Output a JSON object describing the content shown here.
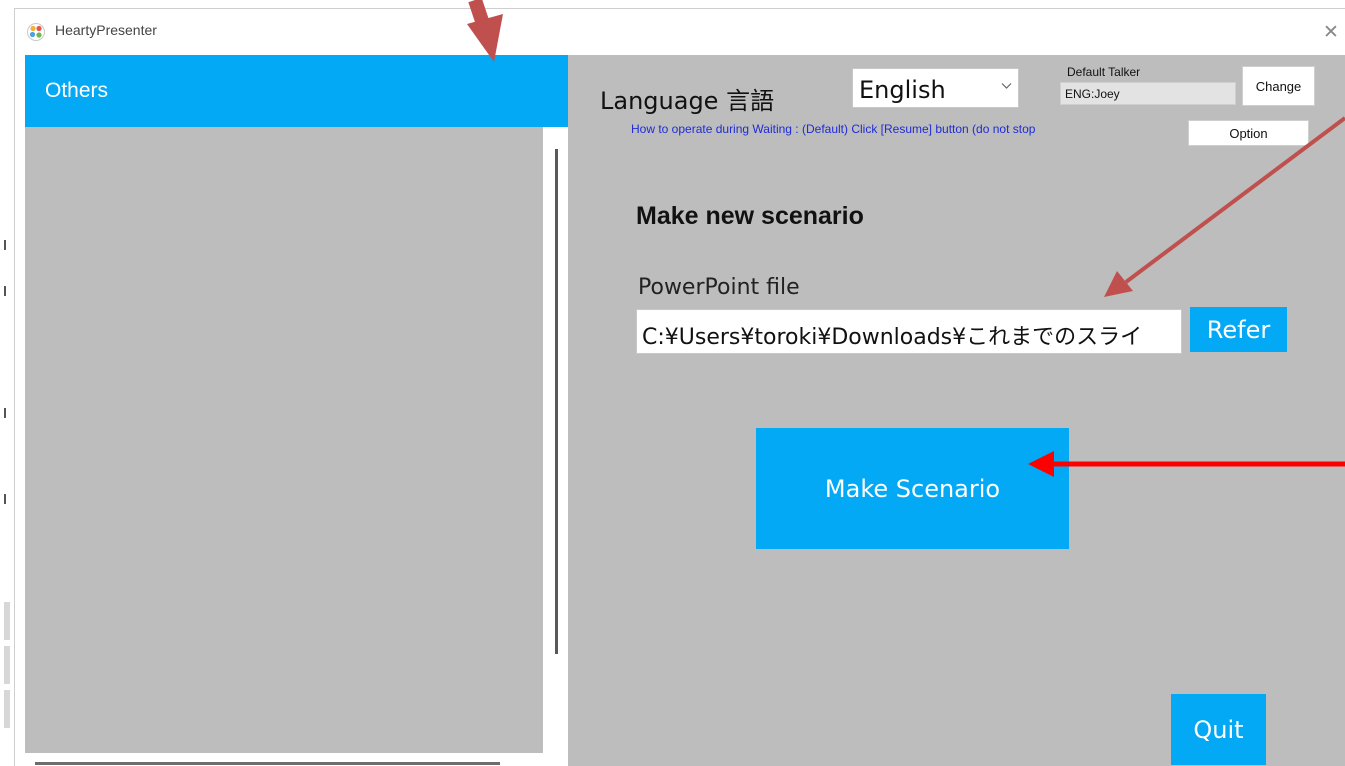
{
  "window": {
    "title": "HeartyPresenter",
    "close_glyph": "✕"
  },
  "sidebar": {
    "header_label": "Others"
  },
  "settings": {
    "language_label": "Language  言語",
    "language_selected": "English",
    "default_talker_label": "Default Talker",
    "default_talker_value": "ENG:Joey",
    "change_label": "Change",
    "waiting_text": "How to operate during Waiting : (Default) Click [Resume] button (do not stop",
    "option_label": "Option"
  },
  "scenario": {
    "title": "Make new scenario",
    "file_label": "PowerPoint file",
    "file_value": "C:¥Users¥toroki¥Downloads¥これまでのスライ",
    "refer_label": "Refer",
    "make_label": "Make Scenario"
  },
  "footer": {
    "quit_label": "Quit"
  },
  "icons": {
    "app": "app-logo-icon",
    "close": "close-icon",
    "dropdown": "chevron-down-icon"
  },
  "colors": {
    "accent": "#03a9f4",
    "panel_gray": "#bdbdbd",
    "link_blue": "#1f2bd6",
    "annotation_arrow": "#c0504d",
    "annotation_arrow_red": "#ff0000"
  }
}
